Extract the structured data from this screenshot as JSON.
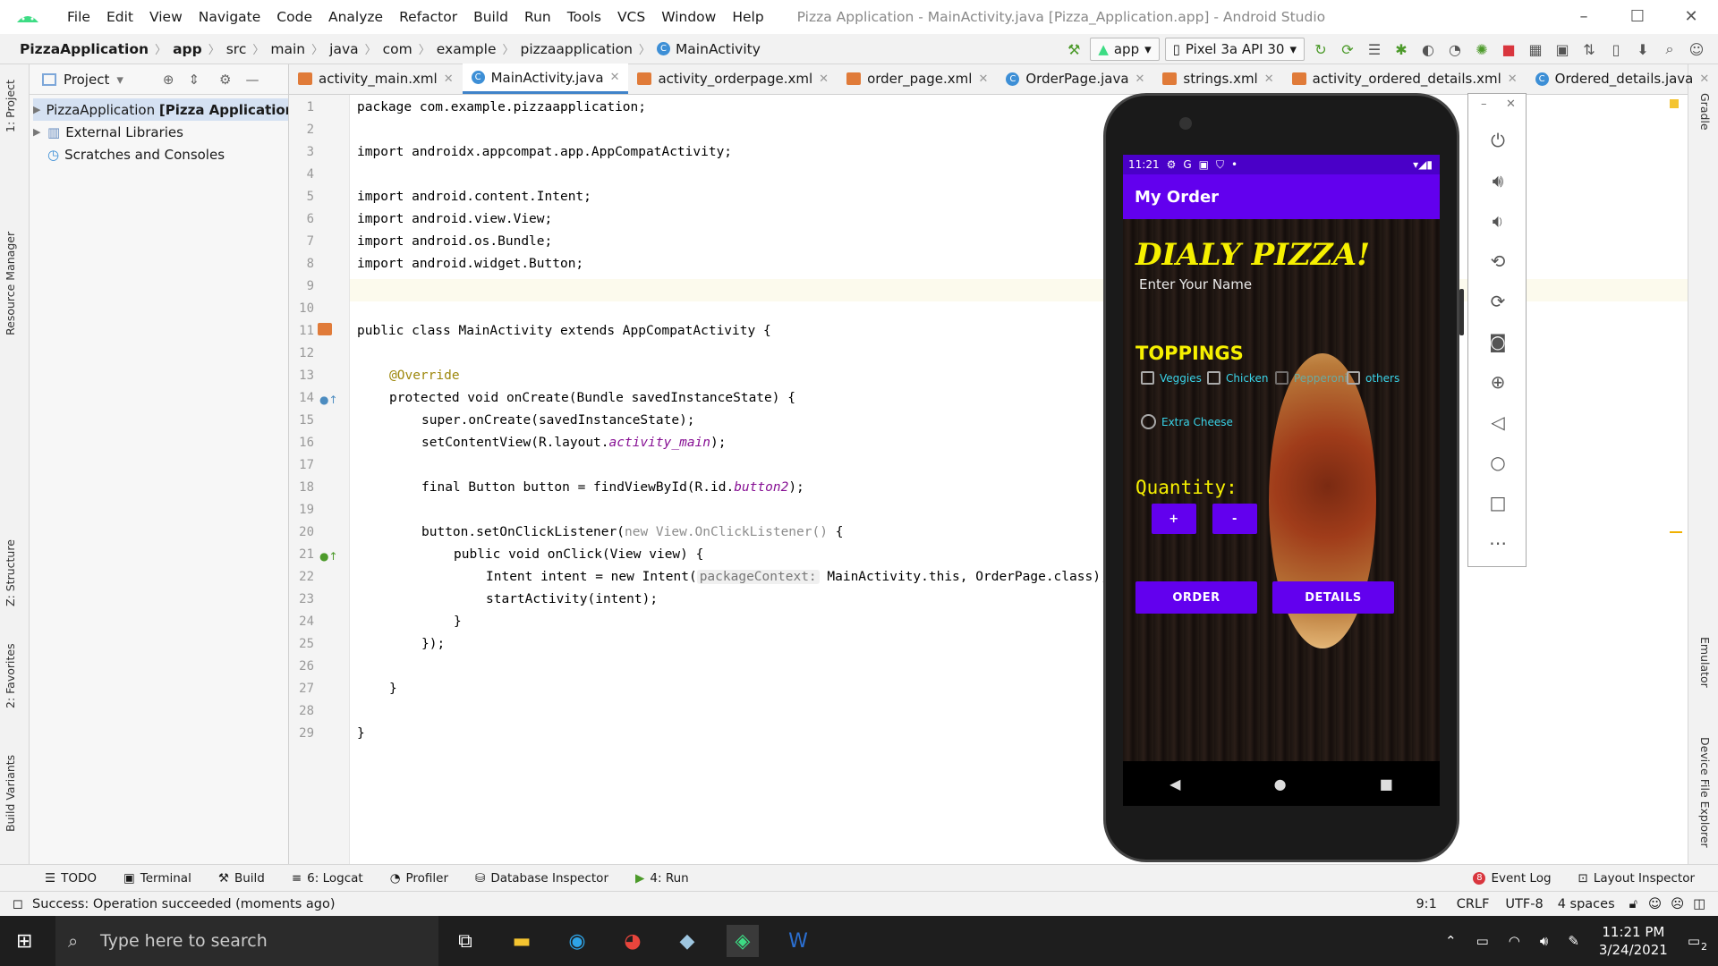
{
  "window": {
    "title": "Pizza Application - MainActivity.java [Pizza_Application.app] - Android Studio",
    "menu": [
      "File",
      "Edit",
      "View",
      "Navigate",
      "Code",
      "Analyze",
      "Refactor",
      "Build",
      "Run",
      "Tools",
      "VCS",
      "Window",
      "Help"
    ],
    "minimize": "–",
    "maximize": "☐",
    "close": "✕"
  },
  "breadcrumb": [
    "PizzaApplication",
    "app",
    "src",
    "main",
    "java",
    "com",
    "example",
    "pizzaapplication",
    "MainActivity"
  ],
  "toolbar": {
    "run_config": "app",
    "device": "Pixel 3a API 30"
  },
  "left_strip": {
    "project": "1: Project",
    "resource_manager": "Resource Manager",
    "structure": "Z: Structure",
    "favorites": "2: Favorites",
    "build_variants": "Build Variants"
  },
  "right_strip": {
    "gradle": "Gradle",
    "emulator": "Emulator",
    "device_file_explorer": "Device File Explorer"
  },
  "project_panel": {
    "title": "Project",
    "items": [
      {
        "label": "PizzaApplication",
        "suffix": "[Pizza Application]"
      },
      {
        "label": "External Libraries"
      },
      {
        "label": "Scratches and Consoles"
      }
    ]
  },
  "tabs": [
    {
      "label": "activity_main.xml",
      "kind": "xml"
    },
    {
      "label": "MainActivity.java",
      "kind": "java",
      "active": true
    },
    {
      "label": "activity_orderpage.xml",
      "kind": "xml"
    },
    {
      "label": "order_page.xml",
      "kind": "xml"
    },
    {
      "label": "OrderPage.java",
      "kind": "java"
    },
    {
      "label": "strings.xml",
      "kind": "xml"
    },
    {
      "label": "activity_ordered_details.xml",
      "kind": "xml"
    },
    {
      "label": "Ordered_details.java",
      "kind": "java"
    }
  ],
  "editor": {
    "line_numbers": [
      "1",
      "2",
      "3",
      "4",
      "5",
      "6",
      "7",
      "8",
      "9",
      "10",
      "11",
      "12",
      "13",
      "14",
      "15",
      "16",
      "17",
      "18",
      "19",
      "20",
      "21",
      "22",
      "23",
      "24",
      "25",
      "26",
      "27",
      "28",
      "29"
    ],
    "code": {
      "l1": "package com.example.pizzaapplication;",
      "l3": "import androidx.appcompat.app.AppCompatActivity;",
      "l5": "import android.content.Intent;",
      "l6": "import android.view.View;",
      "l7": "import android.os.Bundle;",
      "l8": "import android.widget.Button;",
      "l11": "public class MainActivity extends AppCompatActivity {",
      "l13": "@Override",
      "l14": "protected void onCreate(Bundle savedInstanceState) {",
      "l15": "super.onCreate(savedInstanceState);",
      "l16a": "setContentView(R.layout.",
      "l16b": "activity_main",
      "l16c": ");",
      "l18a": "final Button button = findViewById(R.id.",
      "l18b": "button2",
      "l18c": ");",
      "l20a": "button.setOnClickListener(",
      "l20b": "new View.OnClickListener()",
      "l20c": " {",
      "l21": "public void onClick(View view) {",
      "l22a": "Intent intent = new Intent(",
      "l22hint": "packageContext:",
      "l22b": " MainActivity.this, OrderPage.class);",
      "l23": "startActivity(intent);",
      "l24": "}",
      "l25": "});",
      "l27": "}",
      "l29": "}"
    }
  },
  "phone": {
    "status_time": "11:21",
    "app_title": "My Order",
    "headline": "DIALY PIZZA!",
    "name_hint": "Enter Your Name",
    "toppings_label": "TOPPINGS",
    "toppings": [
      "Veggies",
      "Chicken",
      "Pepperoni",
      "others"
    ],
    "extra_cheese": "Extra Cheese",
    "quantity_label": "Quantity:",
    "plus": "+",
    "minus": "-",
    "order_button": "ORDER",
    "details_button": "DETAILS",
    "nav_back": "◀",
    "nav_home": "●",
    "nav_recent": "■"
  },
  "bottom_bar": {
    "todo": "TODO",
    "terminal": "Terminal",
    "build": "Build",
    "logcat": "6: Logcat",
    "profiler": "Profiler",
    "db_inspector": "Database Inspector",
    "run": "4: Run",
    "event_log": "Event Log",
    "event_log_count": "8",
    "layout_inspector": "Layout Inspector"
  },
  "status": {
    "message": "Success: Operation succeeded (moments ago)",
    "position": "9:1",
    "line_sep": "CRLF",
    "encoding": "UTF-8",
    "indent": "4 spaces"
  },
  "taskbar": {
    "search_placeholder": "Type here to search",
    "time": "11:21 PM",
    "date": "3/24/2021",
    "notifications": "2"
  },
  "colors": {
    "accent": "#6200ee",
    "editor_keyword": "#0033b3",
    "tab_underline": "#4083c9"
  }
}
